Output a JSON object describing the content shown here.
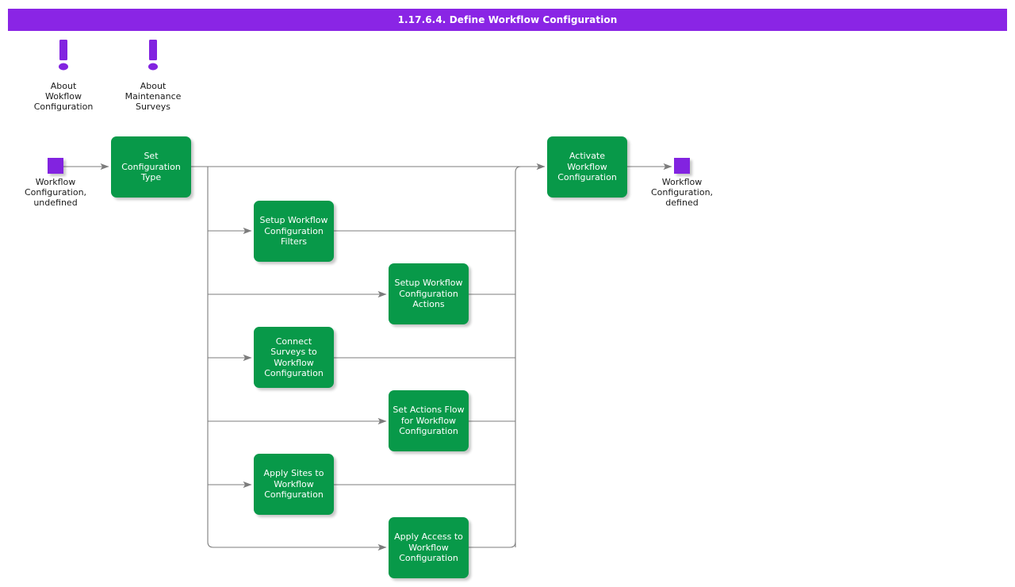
{
  "titlebar": {
    "title": "1.17.6.4. Define Workflow Configuration",
    "bg_color": "#8a25e5",
    "text_color": "#ffffff"
  },
  "theme": {
    "node_green": "#089949",
    "terminator_purple": "#8223e0",
    "note_purple": "#8223e0",
    "wire_gray": "#7c7c7c",
    "page_bg": "#ffffff",
    "label_text": "#1a1a1a"
  },
  "notes": [
    {
      "id": "about-workflow-configuration",
      "icon": "exclamation-mark-icon",
      "label": "About\nWokflow\nConfiguration"
    },
    {
      "id": "about-maintenance-surveys",
      "icon": "exclamation-mark-icon",
      "label": "About\nMaintenance\nSurveys"
    }
  ],
  "terminators": [
    {
      "id": "start",
      "shape": "square",
      "label": "Workflow\nConfiguration,\nundefined"
    },
    {
      "id": "end",
      "shape": "square",
      "label": "Workflow\nConfiguration,\ndefined"
    }
  ],
  "nodes": [
    {
      "id": "set-configuration-type",
      "label": "Set\nConfiguration\nType"
    },
    {
      "id": "setup-workflow-configuration-filters",
      "label": "Setup Workflow\nConfiguration\nFilters"
    },
    {
      "id": "setup-workflow-configuration-actions",
      "label": "Setup Workflow\nConfiguration\nActions"
    },
    {
      "id": "connect-surveys-to-workflow-configuration",
      "label": "Connect\nSurveys to\nWorkflow\nConfiguration"
    },
    {
      "id": "set-actions-flow-for-workflow-configuration",
      "label": "Set Actions Flow\nfor Workflow\nConfiguration"
    },
    {
      "id": "apply-sites-to-workflow-configuration",
      "label": "Apply Sites to\nWorkflow\nConfiguration"
    },
    {
      "id": "apply-access-to-workflow-configuration",
      "label": "Apply Access to\nWorkflow\nConfiguration"
    },
    {
      "id": "activate-workflow-configuration",
      "label": "Activate\nWorkflow\nConfiguration"
    }
  ]
}
